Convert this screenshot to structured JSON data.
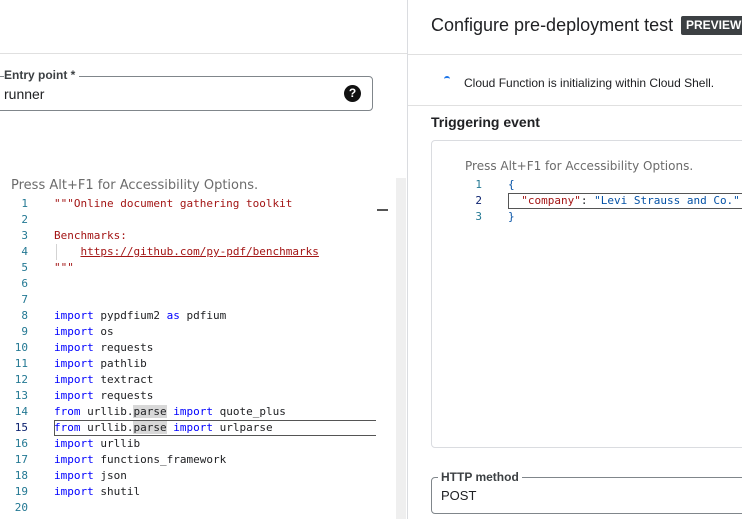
{
  "entry_point": {
    "label": "Entry point *",
    "value": "runner",
    "help_glyph": "?"
  },
  "source_editor": {
    "a11y_hint": "Press Alt+F1 for Accessibility Options.",
    "lines": [
      {
        "n": "1",
        "html": "<span class=\"str\">\"\"\"Online document gathering toolkit</span>"
      },
      {
        "n": "2",
        "html": ""
      },
      {
        "n": "3",
        "html": "<span class=\"str\">Benchmarks:</span>"
      },
      {
        "n": "4",
        "html": "    <span class=\"url\">https://github.com/py-pdf/benchmarks</span>"
      },
      {
        "n": "5",
        "html": "<span class=\"str\">\"\"\"</span>"
      },
      {
        "n": "6",
        "html": ""
      },
      {
        "n": "7",
        "html": ""
      },
      {
        "n": "8",
        "html": "<span class=\"kw\">import</span> pypdfium2 <span class=\"kw\">as</span> pdfium"
      },
      {
        "n": "9",
        "html": "<span class=\"kw\">import</span> os"
      },
      {
        "n": "10",
        "html": "<span class=\"kw\">import</span> requests"
      },
      {
        "n": "11",
        "html": "<span class=\"kw\">import</span> pathlib"
      },
      {
        "n": "12",
        "html": "<span class=\"kw\">import</span> textract"
      },
      {
        "n": "13",
        "html": "<span class=\"kw\">import</span> requests"
      },
      {
        "n": "14",
        "html": "<span class=\"kw\">from</span> urllib.<span class=\"hl\">parse</span> <span class=\"kw\">import</span> quote_plus"
      },
      {
        "n": "15",
        "html": "<span class=\"kw\">from</span> urllib.<span class=\"hl\">parse</span> <span class=\"kw\">import</span> urlparse",
        "active": true
      },
      {
        "n": "16",
        "html": "<span class=\"kw\">import</span> urllib"
      },
      {
        "n": "17",
        "html": "<span class=\"kw\">import</span> functions_framework"
      },
      {
        "n": "18",
        "html": "<span class=\"kw\">import</span> json"
      },
      {
        "n": "19",
        "html": "<span class=\"kw\">import</span> shutil"
      },
      {
        "n": "20",
        "html": ""
      }
    ]
  },
  "panel": {
    "title": "Configure pre-deployment test",
    "badge": "PREVIEW",
    "status": "Cloud Function is initializing within Cloud Shell.",
    "triggering_label": "Triggering event"
  },
  "event_editor": {
    "a11y_hint": "Press Alt+F1 for Accessibility Options.",
    "lines": [
      {
        "n": "1",
        "html": "<span class=\"brace\">{</span>"
      },
      {
        "n": "2",
        "html": "  <span class=\"jkey\">\"company\"</span>: <span class=\"jval\">\"Levi Strauss and Co.\"</span>",
        "active": true
      },
      {
        "n": "3",
        "html": "<span class=\"brace\">}</span>"
      }
    ]
  },
  "http_method": {
    "label": "HTTP method",
    "value": "POST"
  }
}
